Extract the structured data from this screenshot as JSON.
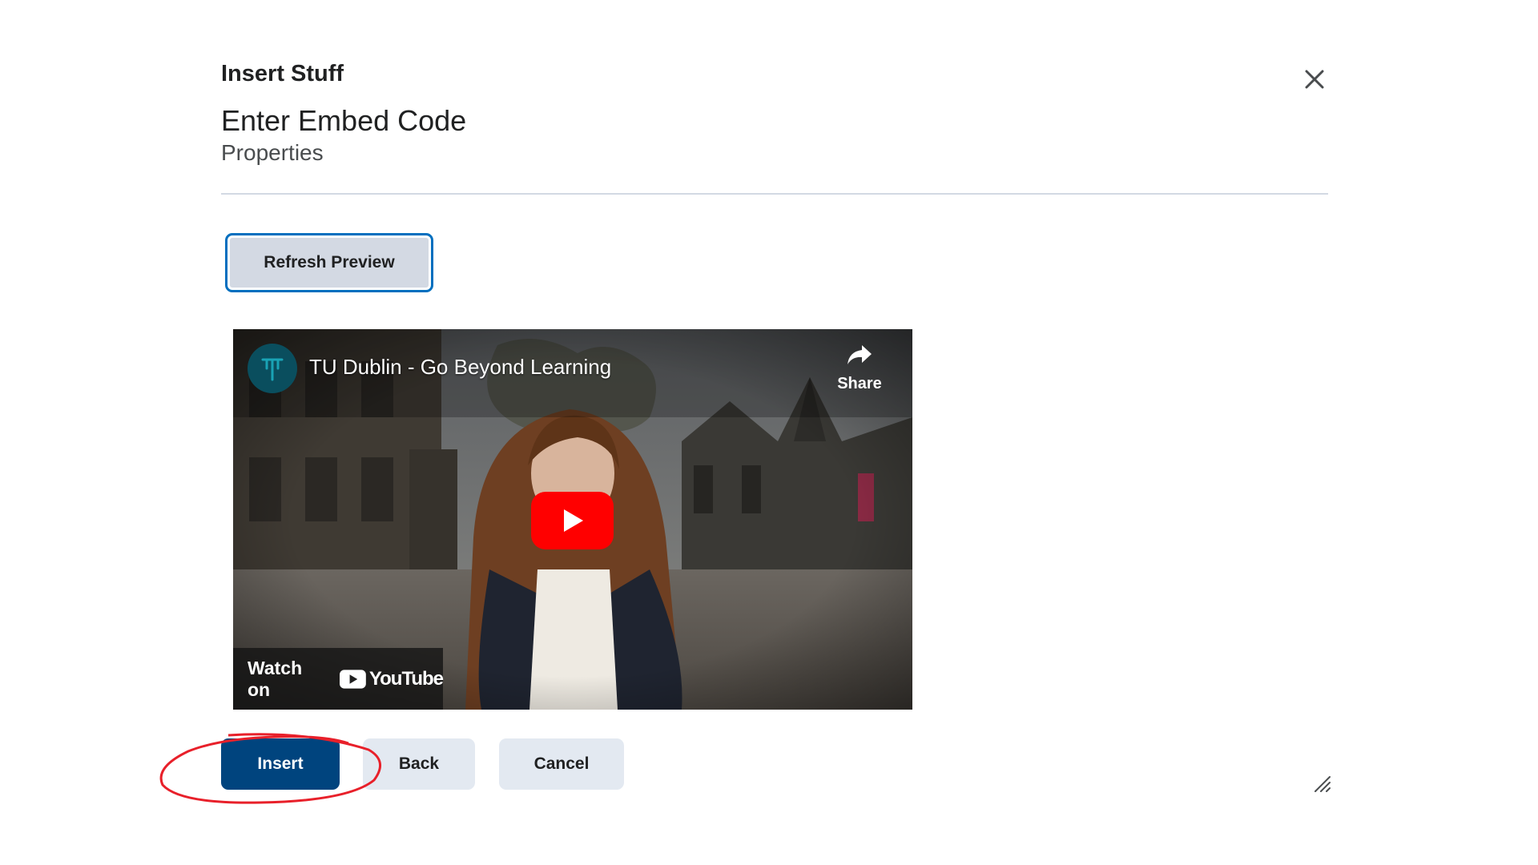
{
  "dialog": {
    "title": "Insert Stuff",
    "step_title": "Enter Embed Code",
    "step_subtitle": "Properties",
    "close_icon": "close-icon"
  },
  "preview": {
    "refresh_label": "Refresh Preview"
  },
  "video": {
    "title": "TU Dublin - Go Beyond Learning",
    "share_label": "Share",
    "watch_on_label": "Watch on",
    "platform_name": "YouTube",
    "play_color": "#ff0000"
  },
  "footer": {
    "insert_label": "Insert",
    "back_label": "Back",
    "cancel_label": "Cancel"
  },
  "colors": {
    "primary": "#00447e",
    "focus_ring": "#006fbf",
    "secondary_button": "#e3e9f1",
    "annotation": "#e8202a"
  }
}
